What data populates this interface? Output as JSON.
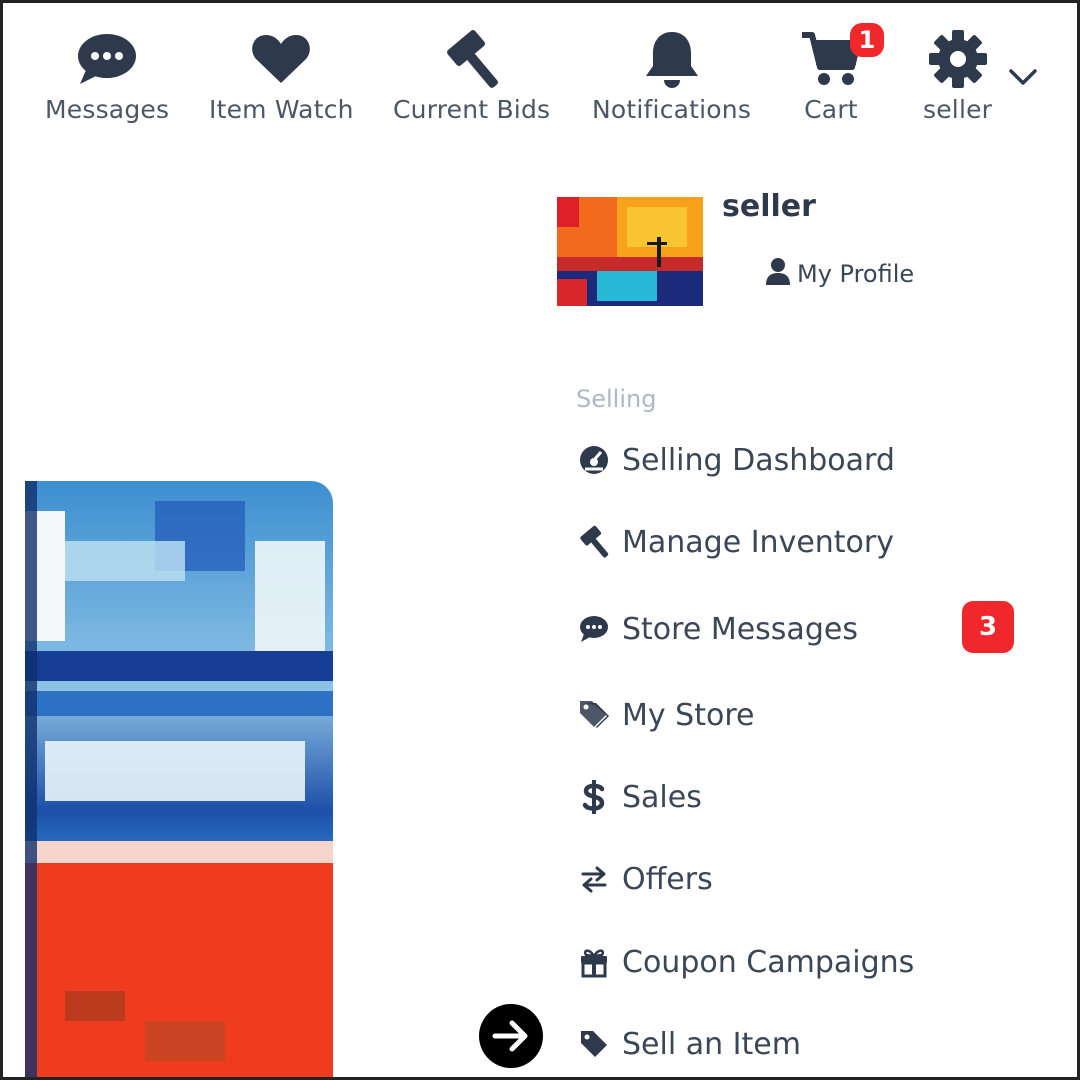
{
  "nav": {
    "messages": {
      "label": "Messages",
      "icon": "chat-bubble-icon"
    },
    "item_watch": {
      "label": "Item Watch",
      "icon": "heart-icon"
    },
    "current_bids": {
      "label": "Current Bids",
      "icon": "gavel-icon"
    },
    "notifications": {
      "label": "Notifications",
      "icon": "bell-icon"
    },
    "cart": {
      "label": "Cart",
      "icon": "cart-icon",
      "badge": "1"
    },
    "account": {
      "label": "seller",
      "icon": "gear-icon"
    }
  },
  "profile": {
    "name": "seller",
    "my_profile_label": "My Profile"
  },
  "selling_menu": {
    "section_label": "Selling",
    "items": [
      {
        "label": "Selling Dashboard",
        "icon": "dashboard-gauge-icon"
      },
      {
        "label": "Manage Inventory",
        "icon": "gavel-icon"
      },
      {
        "label": "Store Messages",
        "icon": "chat-bubble-icon",
        "badge": "3"
      },
      {
        "label": "My Store",
        "icon": "tags-icon"
      },
      {
        "label": "Sales",
        "icon": "dollar-icon"
      },
      {
        "label": "Offers",
        "icon": "exchange-arrows-icon"
      },
      {
        "label": "Coupon Campaigns",
        "icon": "gift-icon"
      },
      {
        "label": "Sell an Item",
        "icon": "tag-icon"
      }
    ]
  },
  "colors": {
    "icon": "#2e3a4c",
    "text": "#3b4656",
    "badge": "#f0282c",
    "section_label": "#aeb8c6"
  }
}
